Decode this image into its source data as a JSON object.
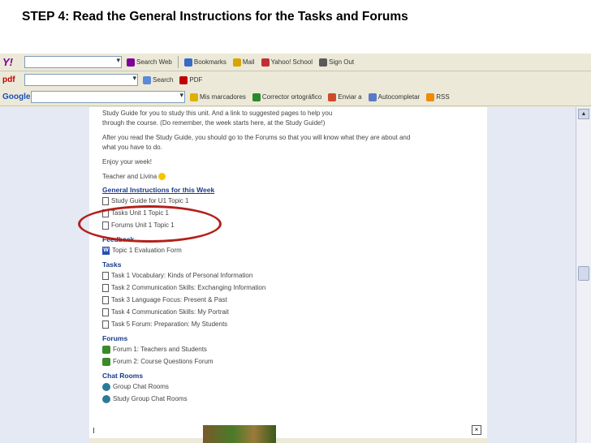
{
  "slide_title": "STEP  4: Read the General Instructions for the Tasks and Forums",
  "toolbars": {
    "yahoo": {
      "logo": "Y!",
      "items": [
        "Search Web",
        "Bookmarks",
        "Mail",
        "Yahoo! School",
        "Sign Out"
      ]
    },
    "pdf": {
      "logo": "pdf",
      "items": [
        "Search",
        "PDF"
      ]
    },
    "google": {
      "logo": "Google",
      "items": [
        "Mis marcadores",
        "Corrector ortográfico",
        "Enviar a",
        "Autocompletar",
        "RSS"
      ]
    }
  },
  "content": {
    "paragraphs": [
      "Study Guide for you to study this unit. And a link to suggested pages to help you",
      "through the course.  (Do remember, the week starts here, at the Study Guide!)",
      "",
      "After you read the Study Guide, you should go to the Forums so that you will know what they are about and",
      "what you have to do.",
      "",
      "Enjoy your week!",
      "",
      "Teacher and Livina"
    ],
    "general": {
      "heading": "General Instructions for this Week",
      "items": [
        "Study Guide for U1 Topic 1",
        "Tasks Unit 1 Topic 1",
        "Forums Unit 1 Topic 1"
      ]
    },
    "feedback": {
      "heading": "Feedback",
      "items": [
        "Topic 1 Evaluation Form"
      ]
    },
    "tasks": {
      "heading": "Tasks",
      "items": [
        "Task 1 Vocabulary: Kinds of Personal Information",
        "Task 2 Communication Skills: Exchanging Information",
        "Task 3 Language Focus: Present & Past",
        "Task 4 Communication Skills: My Portrait",
        "Task 5 Forum: Preparation: My Students"
      ]
    },
    "forums": {
      "heading": "Forums",
      "items": [
        "Forum 1: Teachers and Students",
        "Forum 2: Course Questions Forum"
      ]
    },
    "chat": {
      "heading": "Chat Rooms",
      "items": [
        "Group Chat Rooms",
        "Study Group Chat Rooms"
      ]
    }
  },
  "colors": {
    "annotation_circle": "#b3201a",
    "section_heading": "#1a3a8a"
  }
}
